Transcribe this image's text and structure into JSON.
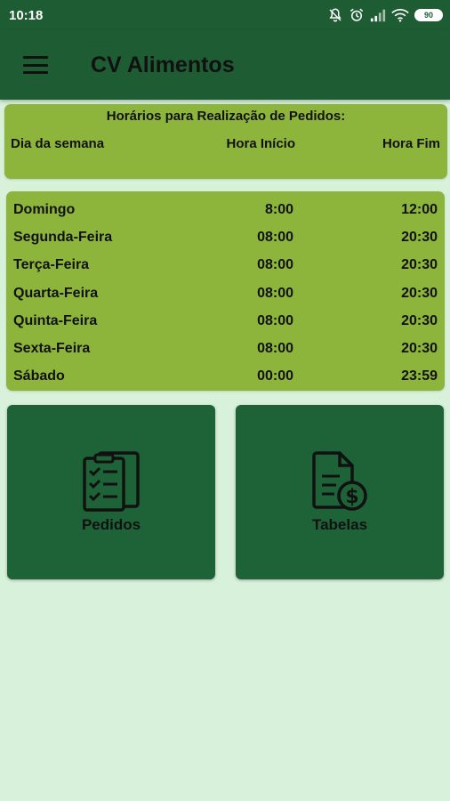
{
  "status": {
    "time": "10:18",
    "battery": "90"
  },
  "app": {
    "title": "CV Alimentos"
  },
  "header": {
    "title": "Horários para Realização de Pedidos:",
    "col_day": "Dia da semana",
    "col_start": "Hora Início",
    "col_end": "Hora Fim"
  },
  "schedule": [
    {
      "day": "Domingo",
      "start": "8:00",
      "end": "12:00"
    },
    {
      "day": "Segunda-Feira",
      "start": "08:00",
      "end": "20:30"
    },
    {
      "day": "Terça-Feira",
      "start": "08:00",
      "end": "20:30"
    },
    {
      "day": "Quarta-Feira",
      "start": "08:00",
      "end": "20:30"
    },
    {
      "day": "Quinta-Feira",
      "start": "08:00",
      "end": "20:30"
    },
    {
      "day": "Sexta-Feira",
      "start": "08:00",
      "end": "20:30"
    },
    {
      "day": "Sábado",
      "start": "00:00",
      "end": "23:59"
    }
  ],
  "tiles": {
    "orders": {
      "label": "Pedidos",
      "icon": "clipboard-checklist-icon"
    },
    "tables": {
      "label": "Tabelas",
      "icon": "document-dollar-icon"
    }
  },
  "colors": {
    "primary_dark": "#1e5c33",
    "card_green": "#8db53c",
    "background": "#d8f1da",
    "tile_green": "#1e6237"
  }
}
